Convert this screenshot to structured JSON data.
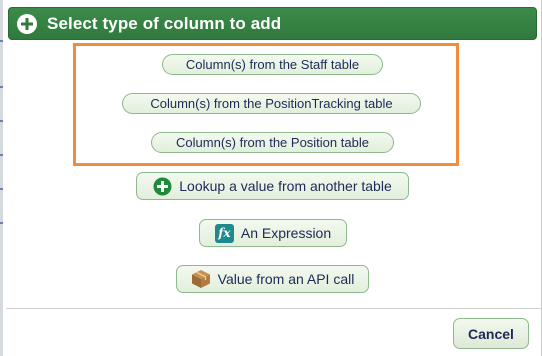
{
  "dialog": {
    "title": "Select type of column to add",
    "header_icon": "plus-circle-icon"
  },
  "options": {
    "staff": "Column(s) from the Staff table",
    "position_tracking": "Column(s) from the PositionTracking table",
    "position": "Column(s) from the Position table"
  },
  "actions": {
    "lookup": {
      "label": "Lookup a value from another table",
      "icon": "plus-circle-icon"
    },
    "expression": {
      "label": "An Expression",
      "icon": "fx-icon",
      "icon_text": "fx"
    },
    "api": {
      "label": "Value from an API call",
      "icon": "box-icon"
    }
  },
  "footer": {
    "cancel": "Cancel"
  },
  "colors": {
    "header_bg": "#2f7a3c",
    "highlight": "#f08c3a",
    "button_text": "#1d2a57",
    "fx_bg": "#1f8a8e"
  }
}
